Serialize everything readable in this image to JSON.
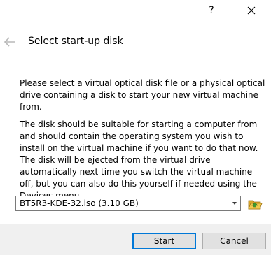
{
  "window": {
    "help_label": "?",
    "close_icon": "close-icon"
  },
  "page": {
    "title": "Select start-up disk",
    "back_icon": "back-arrow-icon"
  },
  "content": {
    "paragraph1": "Please select a virtual optical disk file or a physical optical drive containing a disk to start your new virtual machine from.",
    "paragraph2": "The disk should be suitable for starting a computer from and should contain the operating system you wish to install on the virtual machine if you want to do that now. The disk will be ejected from the virtual drive automatically next time you switch the virtual machine off, but you can also do this yourself if needed using the Devices menu."
  },
  "disk_selector": {
    "selected": "BT5R3-KDE-32.iso (3.10 GB)",
    "browse_icon": "folder-open-icon"
  },
  "buttons": {
    "start": "Start",
    "cancel": "Cancel"
  },
  "colors": {
    "accent": "#0078d7",
    "footer_bg": "#f0f0f0",
    "folder_yellow": "#e8b838",
    "folder_arrow": "#3c9a2e"
  }
}
